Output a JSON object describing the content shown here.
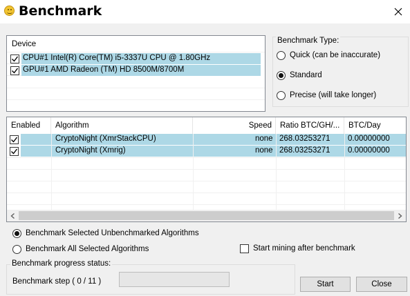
{
  "window": {
    "title": "Benchmark"
  },
  "device_list": {
    "header": "Device",
    "items": [
      {
        "label": "CPU#1 Intel(R) Core(TM) i5-3337U CPU @ 1.80GHz",
        "checked": true
      },
      {
        "label": "GPU#1 AMD Radeon (TM) HD 8500M/8700M",
        "checked": true
      }
    ]
  },
  "benchmark_type": {
    "label": "Benchmark Type:",
    "options": [
      {
        "label": "Quick (can be inaccurate)",
        "selected": false
      },
      {
        "label": "Standard",
        "selected": true
      },
      {
        "label": "Precise (will take longer)",
        "selected": false
      }
    ]
  },
  "algorithms": {
    "columns": [
      "Enabled",
      "Algorithm",
      "Speed",
      "Ratio BTC/GH/...",
      "BTC/Day"
    ],
    "rows": [
      {
        "enabled": true,
        "algorithm": "CryptoNight (XmrStackCPU)",
        "speed": "none",
        "ratio": "268.03253271",
        "btc_day": "0.00000000"
      },
      {
        "enabled": true,
        "algorithm": "CryptoNight (Xmrig)",
        "speed": "none",
        "ratio": "268.03253271",
        "btc_day": "0.00000000"
      }
    ]
  },
  "run_options": {
    "selected_unbenchmarked": "Benchmark Selected Unbenchmarked Algorithms",
    "all_selected": "Benchmark All Selected Algorithms",
    "start_mining_after": "Start mining after benchmark"
  },
  "progress": {
    "label": "Benchmark progress status:",
    "step_text": "Benchmark step ( 0 / 11 )",
    "fraction": 0
  },
  "buttons": {
    "start": "Start",
    "close": "Close"
  },
  "colors": {
    "selection": "#add8e6",
    "window_bg": "#f0f0f0"
  }
}
